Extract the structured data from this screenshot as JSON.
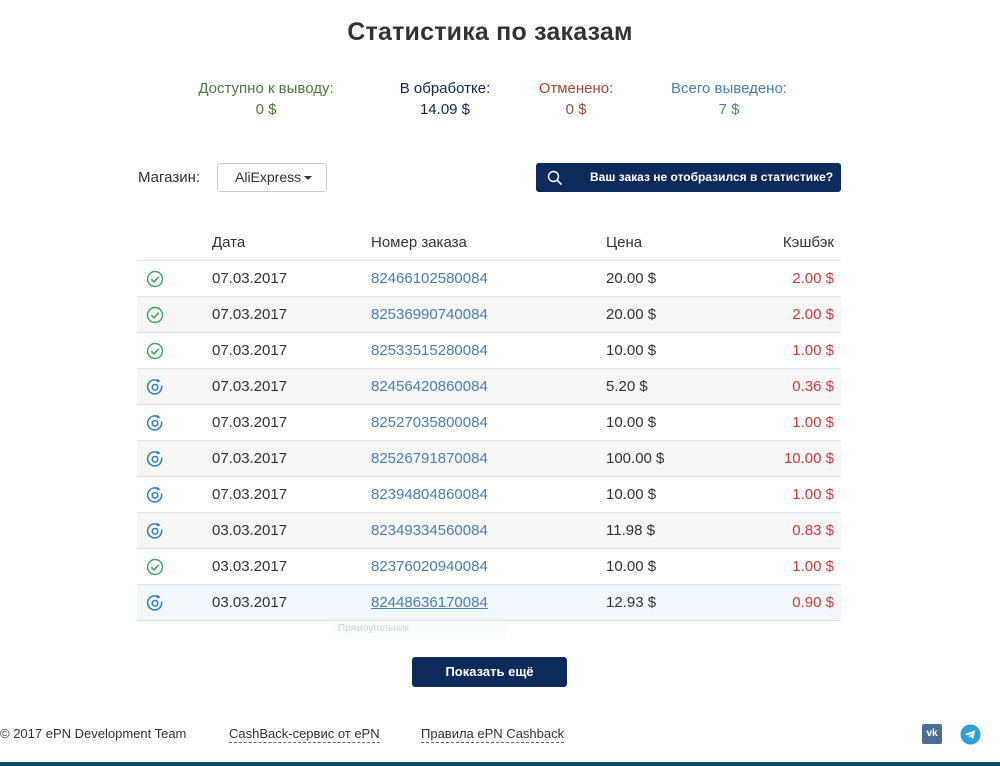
{
  "page": {
    "title": "Статистика по заказам"
  },
  "stats": {
    "available": {
      "label": "Доступно к выводу:",
      "value": "0 $"
    },
    "processing": {
      "label": "В обработке:",
      "value": "14.09 $"
    },
    "cancelled": {
      "label": "Отменено:",
      "value": "0 $"
    },
    "withdrawn": {
      "label": "Всего выведено:",
      "value": "7 $"
    }
  },
  "filters": {
    "store_label": "Магазин:",
    "store_value": "AliExpress",
    "missing_order_label": "Ваш заказ не отобразился в статистике?"
  },
  "table": {
    "headers": {
      "date": "Дата",
      "order": "Номер заказа",
      "price": "Цена",
      "cashback": "Кэшбэк"
    },
    "rows": [
      {
        "status": "approved",
        "date": "07.03.2017",
        "order": "82466102580084",
        "price": "20.00 $",
        "cashback": "2.00 $"
      },
      {
        "status": "approved",
        "date": "07.03.2017",
        "order": "82536990740084",
        "price": "20.00 $",
        "cashback": "2.00 $"
      },
      {
        "status": "approved",
        "date": "07.03.2017",
        "order": "82533515280084",
        "price": "10.00 $",
        "cashback": "1.00 $"
      },
      {
        "status": "processing",
        "date": "07.03.2017",
        "order": "82456420860084",
        "price": "5.20 $",
        "cashback": "0.36 $"
      },
      {
        "status": "processing",
        "date": "07.03.2017",
        "order": "82527035800084",
        "price": "10.00 $",
        "cashback": "1.00 $"
      },
      {
        "status": "processing",
        "date": "07.03.2017",
        "order": "82526791870084",
        "price": "100.00 $",
        "cashback": "10.00 $"
      },
      {
        "status": "processing",
        "date": "07.03.2017",
        "order": "82394804860084",
        "price": "10.00 $",
        "cashback": "1.00 $"
      },
      {
        "status": "processing",
        "date": "03.03.2017",
        "order": "82349334560084",
        "price": "11.98 $",
        "cashback": "0.83 $"
      },
      {
        "status": "approved",
        "date": "03.03.2017",
        "order": "82376020940084",
        "price": "10.00 $",
        "cashback": "1.00 $"
      },
      {
        "status": "processing",
        "date": "03.03.2017",
        "order": "82448636170084",
        "price": "12.93 $",
        "cashback": "0.90 $"
      }
    ],
    "tooltip": "Прямоугольник"
  },
  "show_more_label": "Показать ещё",
  "footer": {
    "copyright": "© 2017 ePN Development Team",
    "link1": "CashBack-сервис от ePN",
    "link2": "Правила ePN Cashback",
    "vk_text": "vk"
  },
  "icons": {
    "approved": "check-circle-icon",
    "processing": "refresh-circle-icon",
    "search": "search-icon",
    "vk": "vk-icon",
    "telegram": "telegram-icon"
  },
  "colors": {
    "navy_button": "#0d2a5c",
    "approved_green": "#3aa657",
    "processing_blue": "#2a7fc9",
    "cashback_red": "#d23a3a",
    "link_blue": "#4a7fb3"
  }
}
